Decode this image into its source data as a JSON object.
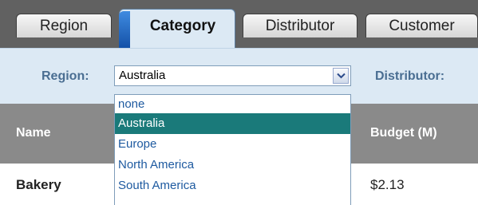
{
  "tabs": [
    {
      "label": "Region"
    },
    {
      "label": "Category"
    },
    {
      "label": "Distributor"
    },
    {
      "label": "Customer"
    }
  ],
  "filters": {
    "region_label": "Region:",
    "region_value": "Australia",
    "distributor_label": "Distributor:"
  },
  "dropdown": {
    "options": [
      "none",
      "Australia",
      "Europe",
      "North America",
      "South America"
    ],
    "selected": "Australia"
  },
  "table": {
    "columns": [
      "Name",
      "Budget (M)"
    ],
    "rows": [
      {
        "name": "Bakery",
        "budget": "$2.13"
      }
    ]
  }
}
